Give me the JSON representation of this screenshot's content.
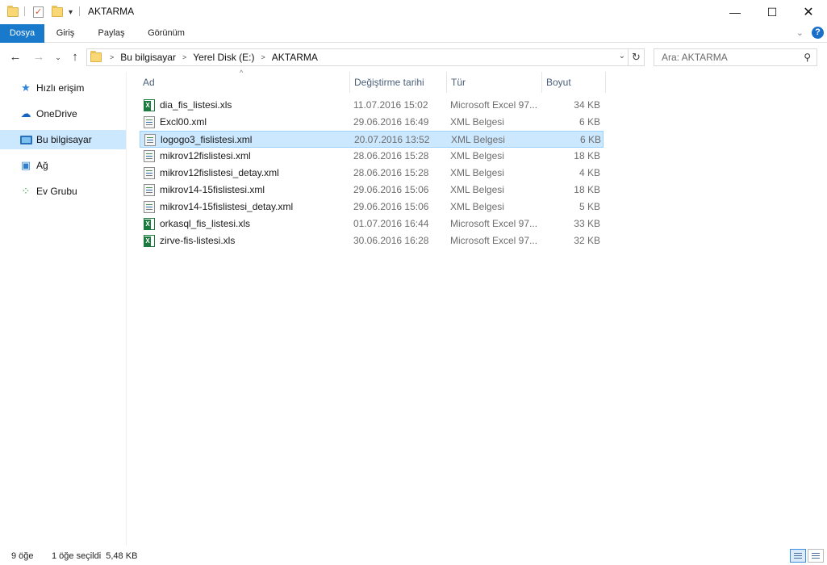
{
  "window": {
    "title": "AKTARMA"
  },
  "ribbon": {
    "tabs": [
      "Dosya",
      "Giriş",
      "Paylaş",
      "Görünüm"
    ]
  },
  "address": {
    "crumbs": [
      "Bu bilgisayar",
      "Yerel Disk (E:)",
      "AKTARMA"
    ]
  },
  "search": {
    "placeholder": "Ara: AKTARMA"
  },
  "sidebar": {
    "items": [
      {
        "label": "Hızlı erişim",
        "icon": "star-icon"
      },
      {
        "label": "OneDrive",
        "icon": "cloud-icon"
      },
      {
        "label": "Bu bilgisayar",
        "icon": "computer-icon",
        "selected": true
      },
      {
        "label": "Ağ",
        "icon": "network-icon"
      },
      {
        "label": "Ev Grubu",
        "icon": "homegroup-icon"
      }
    ]
  },
  "columns": {
    "name": "Ad",
    "date": "Değiştirme tarihi",
    "type": "Tür",
    "size": "Boyut"
  },
  "files": [
    {
      "name": "dia_fis_listesi.xls",
      "date": "11.07.2016 15:02",
      "type": "Microsoft Excel 97...",
      "size": "34 KB",
      "icon": "excel-file-icon"
    },
    {
      "name": "Excl00.xml",
      "date": "29.06.2016 16:49",
      "type": "XML Belgesi",
      "size": "6 KB",
      "icon": "xml-file-icon"
    },
    {
      "name": "logogo3_fislistesi.xml",
      "date": "20.07.2016 13:52",
      "type": "XML Belgesi",
      "size": "6 KB",
      "icon": "xml-file-icon",
      "selected": true
    },
    {
      "name": "mikrov12fislistesi.xml",
      "date": "28.06.2016 15:28",
      "type": "XML Belgesi",
      "size": "18 KB",
      "icon": "xml-file-icon"
    },
    {
      "name": "mikrov12fislistesi_detay.xml",
      "date": "28.06.2016 15:28",
      "type": "XML Belgesi",
      "size": "4 KB",
      "icon": "xml-file-icon"
    },
    {
      "name": "mikrov14-15fislistesi.xml",
      "date": "29.06.2016 15:06",
      "type": "XML Belgesi",
      "size": "18 KB",
      "icon": "xml-file-icon"
    },
    {
      "name": "mikrov14-15fislistesi_detay.xml",
      "date": "29.06.2016 15:06",
      "type": "XML Belgesi",
      "size": "5 KB",
      "icon": "xml-file-icon"
    },
    {
      "name": "orkasql_fis_listesi.xls",
      "date": "01.07.2016 16:44",
      "type": "Microsoft Excel 97...",
      "size": "33 KB",
      "icon": "excel-file-icon"
    },
    {
      "name": "zirve-fis-listesi.xls",
      "date": "30.06.2016 16:28",
      "type": "Microsoft Excel 97...",
      "size": "32 KB",
      "icon": "excel-file-icon"
    }
  ],
  "status": {
    "count": "9 öğe",
    "selection": "1 öğe seçildi  5,48 KB"
  },
  "colors": {
    "accent": "#1979ca",
    "selection": "#cce8ff",
    "selection_border": "#99d1ff"
  }
}
